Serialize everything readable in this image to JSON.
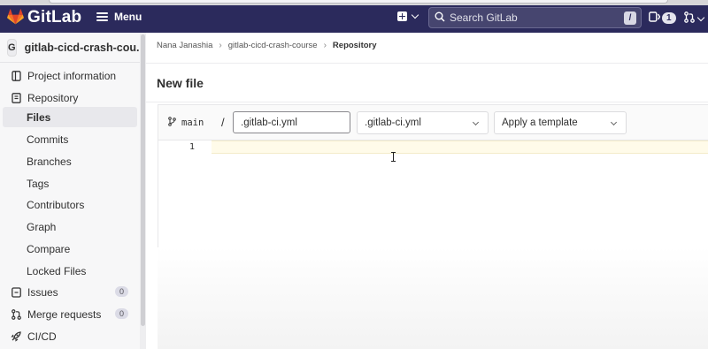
{
  "topbar": {
    "brand": "GitLab",
    "menu_label": "Menu",
    "search_placeholder": "Search GitLab",
    "search_shortcut": "/",
    "mr_count": "1",
    "colors": {
      "background": "#2b2a5c",
      "logo": "#e24329"
    }
  },
  "sidebar": {
    "project_avatar": "G",
    "project_name": "gitlab-cicd-crash-cou...",
    "items": [
      {
        "label": "Project information",
        "icon": "info-icon"
      },
      {
        "label": "Repository",
        "icon": "book-icon"
      },
      {
        "label": "Files",
        "active": true
      },
      {
        "label": "Commits"
      },
      {
        "label": "Branches"
      },
      {
        "label": "Tags"
      },
      {
        "label": "Contributors"
      },
      {
        "label": "Graph"
      },
      {
        "label": "Compare"
      },
      {
        "label": "Locked Files"
      },
      {
        "label": "Issues",
        "icon": "issues-icon",
        "count": "0"
      },
      {
        "label": "Merge requests",
        "icon": "merge-request-icon",
        "count": "0"
      },
      {
        "label": "CI/CD",
        "icon": "rocket-icon"
      }
    ]
  },
  "breadcrumb": {
    "items": [
      "Nana Janashia",
      "gitlab-cicd-crash-course",
      "Repository"
    ],
    "separator": "›"
  },
  "page": {
    "title": "New file",
    "branch": "main",
    "path_separator": "/",
    "filename_value": ".gitlab-ci.yml",
    "file_type_selected": ".gitlab-ci.yml",
    "template_selected": "Apply a template"
  },
  "editor": {
    "line_numbers": [
      "1"
    ]
  }
}
